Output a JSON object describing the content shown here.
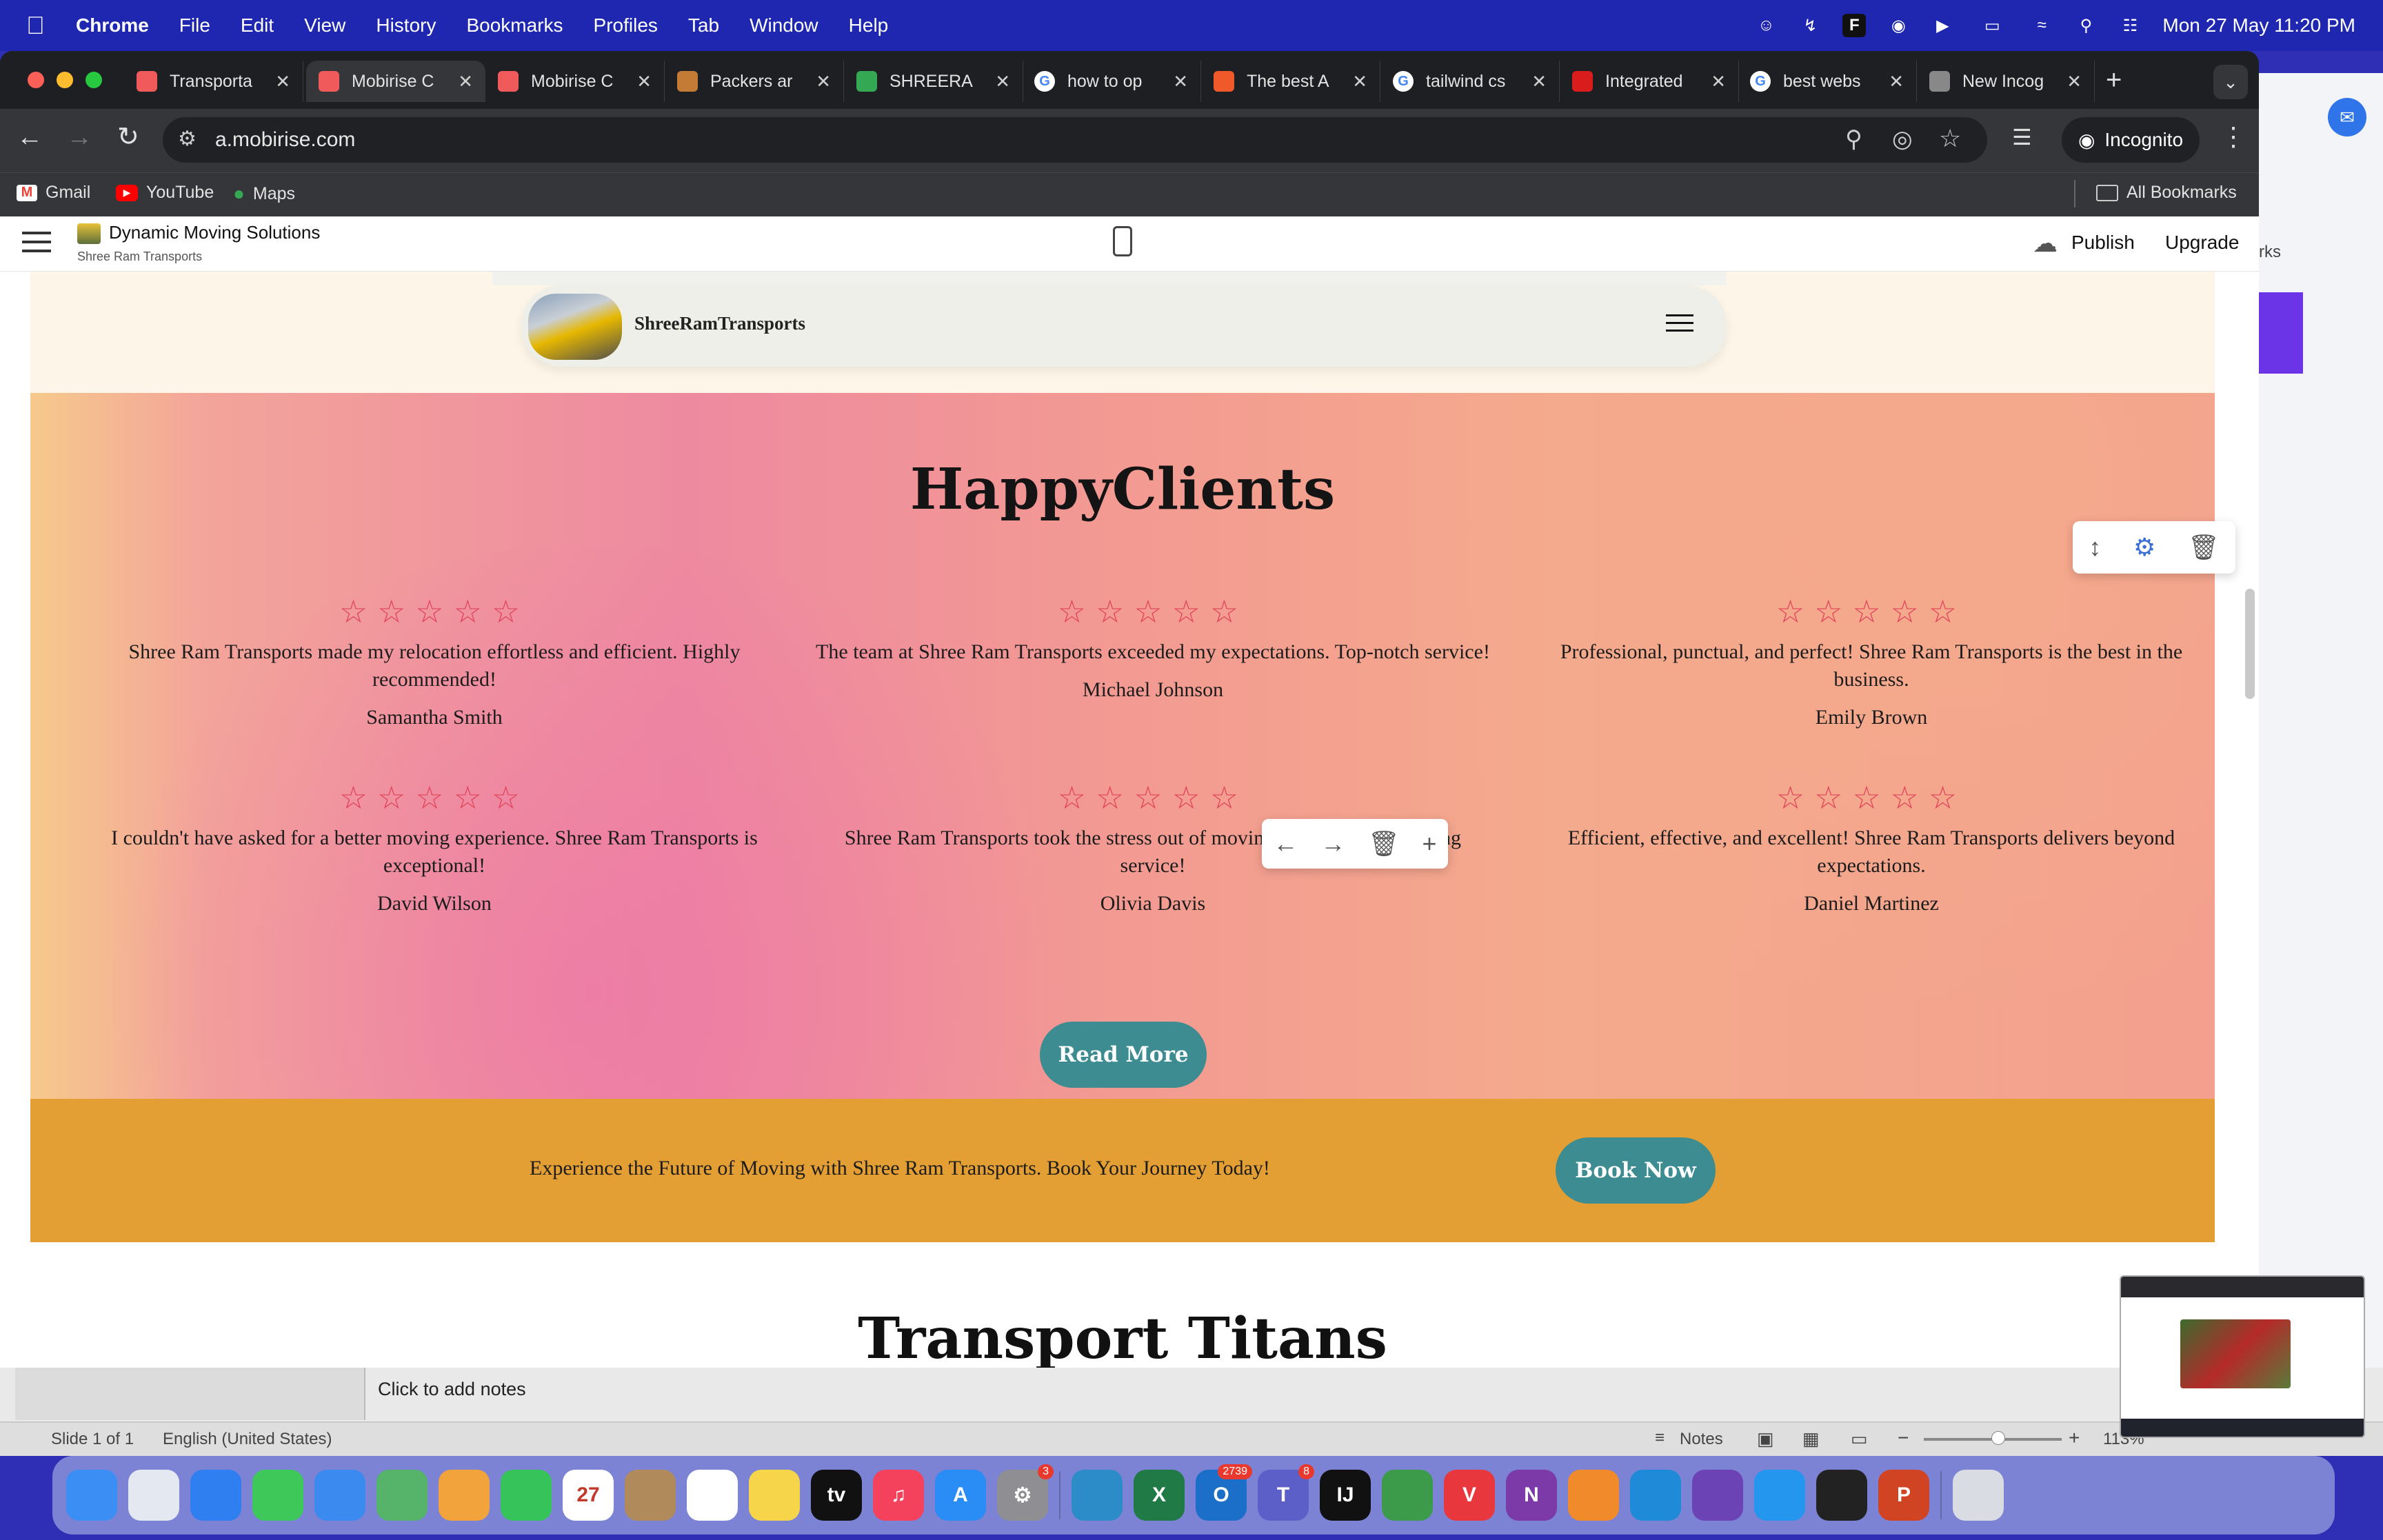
{
  "menubar": {
    "app": "Chrome",
    "items": [
      "File",
      "Edit",
      "View",
      "History",
      "Bookmarks",
      "Profiles",
      "Tab",
      "Window",
      "Help"
    ],
    "clock": "Mon 27 May  11:20 PM"
  },
  "tabs": [
    {
      "title": "Transporta",
      "fav": "mobirise-icon",
      "color": "#f05a5a"
    },
    {
      "title": "Mobirise C",
      "fav": "mobirise-icon",
      "color": "#f05a5a",
      "active": true
    },
    {
      "title": "Mobirise C",
      "fav": "mobirise-icon",
      "color": "#f05a5a"
    },
    {
      "title": "Packers ar",
      "fav": "page-icon",
      "color": "#c47b36"
    },
    {
      "title": "SHREERA",
      "fav": "maps-pin-icon",
      "color": "#34a853"
    },
    {
      "title": "how to op",
      "fav": "google-icon",
      "color": "#ffffff"
    },
    {
      "title": "The best A",
      "fav": "page-icon",
      "color": "#f0592a"
    },
    {
      "title": "tailwind cs",
      "fav": "google-icon",
      "color": "#ffffff"
    },
    {
      "title": "Integrated",
      "fav": "page-icon",
      "color": "#d91d1d"
    },
    {
      "title": "best webs",
      "fav": "google-icon",
      "color": "#ffffff"
    },
    {
      "title": "New Incog",
      "fav": "incognito-icon",
      "color": "#888888"
    }
  ],
  "omnibox": {
    "url": "a.mobirise.com"
  },
  "incognito_label": "Incognito",
  "bookmarks": [
    {
      "label": "Gmail",
      "icon": "gmail-icon",
      "color": "#ea4335"
    },
    {
      "label": "YouTube",
      "icon": "youtube-icon",
      "color": "#ff0000"
    },
    {
      "label": "Maps",
      "icon": "maps-icon",
      "color": "#34a853"
    }
  ],
  "all_bookmarks": "All Bookmarks",
  "mobirise": {
    "project": "Dynamic Moving Solutions",
    "subtitle": "Shree Ram Transports",
    "publish": "Publish",
    "upgrade": "Upgrade"
  },
  "site": {
    "brand": "ShreeRamTransports",
    "heading": "HappyClients",
    "stars": "☆☆☆☆☆",
    "reviews": [
      {
        "text": "Shree Ram Transports made my relocation effortless and efficient. Highly recommended!",
        "name": "Samantha Smith"
      },
      {
        "text": "The team at Shree Ram Transports exceeded my expectations. Top-notch service!",
        "name": "Michael Johnson"
      },
      {
        "text": "Professional, punctual, and perfect! Shree Ram Transports is the best in the business.",
        "name": "Emily Brown"
      },
      {
        "text": "I couldn't have asked for a better moving experience. Shree Ram Transports is exceptional!",
        "name": "David Wilson"
      },
      {
        "text": "Shree Ram Transports took the stress out of moving with their outstanding service!",
        "name": "Olivia Davis"
      },
      {
        "text": "Efficient, effective, and excellent! Shree Ram Transports delivers beyond expectations.",
        "name": "Daniel Martinez"
      }
    ],
    "read_more": "Read More",
    "cta_text": "Experience the Future of Moving with Shree Ram Transports. Book Your Journey Today!",
    "book_now": "Book Now",
    "next_heading": "Transport Titans"
  },
  "powerpoint": {
    "notes_placeholder": "Click to add notes",
    "slide": "Slide 1 of 1",
    "language": "English (United States)",
    "notes": "Notes",
    "zoom": "113%"
  },
  "right_window": {
    "partial_text": "rks"
  },
  "dock": [
    {
      "name": "finder-icon",
      "color": "#3b8ef3",
      "label": ""
    },
    {
      "name": "launchpad-icon",
      "color": "#e4e8f0",
      "label": ""
    },
    {
      "name": "safari-icon",
      "color": "#2f7ff0",
      "label": ""
    },
    {
      "name": "messages-icon",
      "color": "#3ec85a",
      "label": ""
    },
    {
      "name": "mail-icon",
      "color": "#3a8af0",
      "label": ""
    },
    {
      "name": "maps-icon",
      "color": "#55b36a",
      "label": ""
    },
    {
      "name": "photos-icon",
      "color": "#f2a33c",
      "label": ""
    },
    {
      "name": "facetime-icon",
      "color": "#36c45a",
      "label": ""
    },
    {
      "name": "calendar-icon",
      "color": "#ffffff",
      "label": "27"
    },
    {
      "name": "contacts-icon",
      "color": "#b08a5a",
      "label": ""
    },
    {
      "name": "reminders-icon",
      "color": "#ffffff",
      "label": ""
    },
    {
      "name": "notes-icon",
      "color": "#f6d54a",
      "label": ""
    },
    {
      "name": "tv-icon",
      "color": "#111111",
      "label": "tv"
    },
    {
      "name": "music-icon",
      "color": "#f5425c",
      "label": "♫"
    },
    {
      "name": "app-store-icon",
      "color": "#2a8cf5",
      "label": "A"
    },
    {
      "name": "system-settings-icon",
      "color": "#8e8e93",
      "label": "⚙",
      "badge": "3"
    },
    {
      "name": "sourcetree-icon",
      "color": "#2b8cc8",
      "label": ""
    },
    {
      "name": "excel-icon",
      "color": "#1f7a45",
      "label": "X"
    },
    {
      "name": "outlook-icon",
      "color": "#1b6fc8",
      "label": "O",
      "badge": "2739"
    },
    {
      "name": "teams-icon",
      "color": "#5b5fc7",
      "label": "T",
      "badge": "8"
    },
    {
      "name": "intellij-icon",
      "color": "#111111",
      "label": "IJ"
    },
    {
      "name": "chrome-icon",
      "color": "#3c9b4a",
      "label": ""
    },
    {
      "name": "vivaldi-icon",
      "color": "#e8383d",
      "label": "V"
    },
    {
      "name": "onenote-icon",
      "color": "#7c3aa8",
      "label": "N"
    },
    {
      "name": "pages-icon",
      "color": "#f08a2a",
      "label": ""
    },
    {
      "name": "vscode-icon",
      "color": "#1f8ad7",
      "label": ""
    },
    {
      "name": "github-desktop-icon",
      "color": "#6c43b5",
      "label": ""
    },
    {
      "name": "docker-icon",
      "color": "#2496ed",
      "label": ""
    },
    {
      "name": "terminal-icon",
      "color": "#222222",
      "label": ""
    },
    {
      "name": "powerpoint-icon",
      "color": "#d04423",
      "label": "P"
    },
    {
      "name": "trash-icon",
      "color": "#d9dce3",
      "label": ""
    }
  ]
}
